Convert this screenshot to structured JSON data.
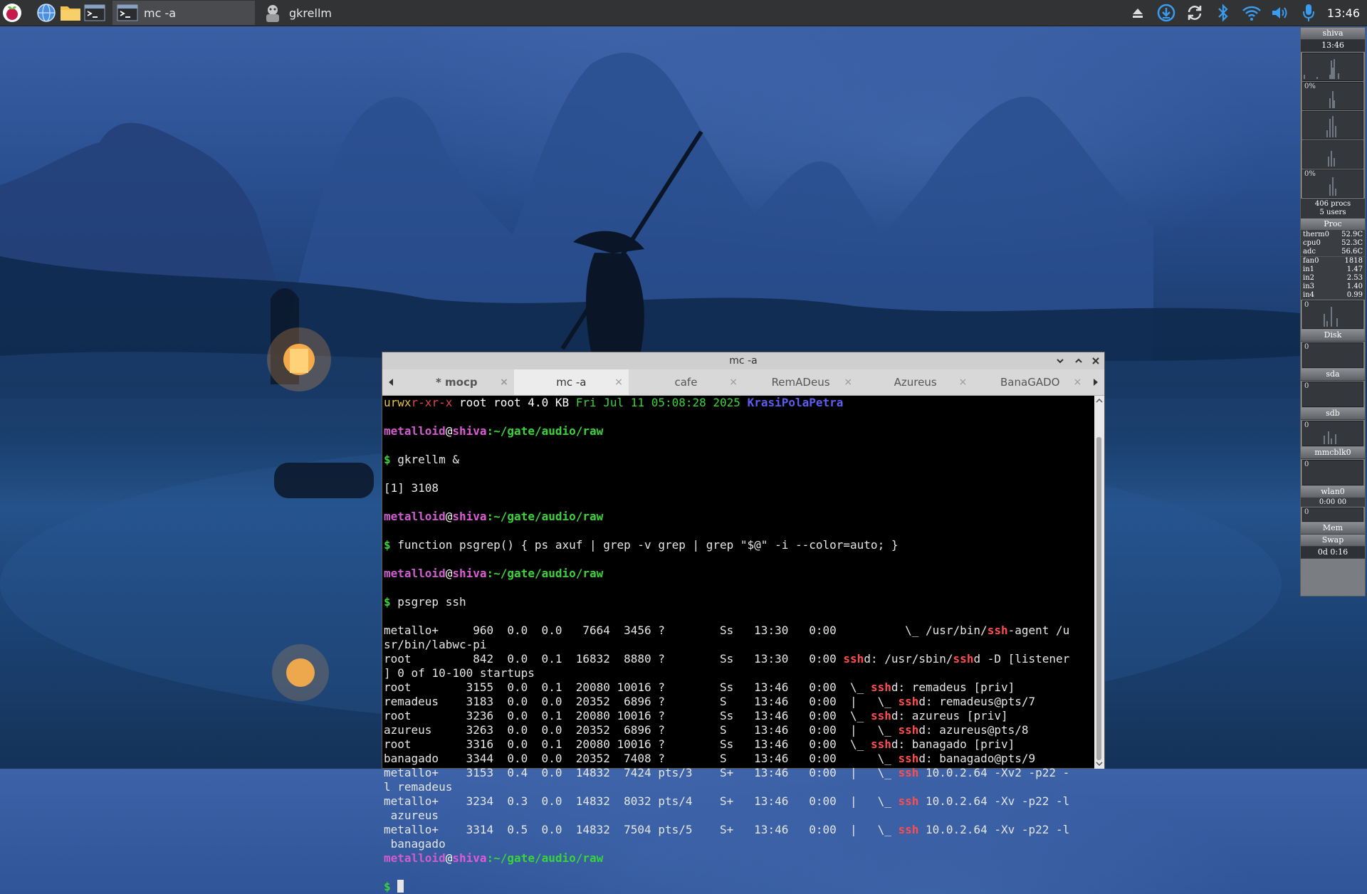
{
  "taskbar": {
    "tasks": [
      {
        "label": "mc -a",
        "active": true
      },
      {
        "label": "gkrellm",
        "active": false
      }
    ],
    "clock": "13:46"
  },
  "gkrellm": {
    "host": "shiva",
    "time": "13:46",
    "cpu1_pct": "0%",
    "cpu2_pct": "0%",
    "procs": "406 procs",
    "users": "5 users",
    "proc_label": "Proc",
    "sensors": [
      {
        "name": "therm0",
        "value": "52.9C"
      },
      {
        "name": "cpu0",
        "value": "52.3C"
      },
      {
        "name": "adc",
        "value": "56.6C"
      }
    ],
    "fan": {
      "name": "fan0",
      "value": "1818"
    },
    "volts": [
      {
        "name": "in1",
        "value": "1.47"
      },
      {
        "name": "in2",
        "value": "2.53"
      },
      {
        "name": "in3",
        "value": "1.40"
      },
      {
        "name": "in4",
        "value": "0.99"
      }
    ],
    "disks": [
      {
        "zero": "0",
        "label": "Disk"
      },
      {
        "zero": "0",
        "label": "sda"
      },
      {
        "zero": "0",
        "label": "sdb"
      },
      {
        "zero": "0",
        "label": "mmcblk0"
      },
      {
        "zero": "0",
        "label": "wlan0"
      }
    ],
    "net_time": "0:00 00",
    "net_zero": "0",
    "mem": "Mem",
    "swap": "Swap",
    "uptime": "0d 0:16"
  },
  "window": {
    "title": "mc -a",
    "tabs": [
      {
        "label": "* mocp",
        "active": false,
        "bold": true
      },
      {
        "label": "mc -a",
        "active": true,
        "bold": false
      },
      {
        "label": "cafe",
        "active": false,
        "bold": false
      },
      {
        "label": "RemADeus",
        "active": false,
        "bold": false
      },
      {
        "label": "Azureus",
        "active": false,
        "bold": false
      },
      {
        "label": "BanaGADO",
        "active": false,
        "bold": false
      }
    ],
    "tab_close": "×"
  },
  "terminal": {
    "header_line": {
      "perms_u": "urwx",
      "perms_g": "r-x",
      "perms_o": "r-x",
      "owner": " root root 4.0 KB ",
      "date": "Fri Jul 11 05:08:28 2025 ",
      "name": "KrasiPolaPetra"
    },
    "prompt": {
      "user": "metalloid",
      "at": "@",
      "host": "shiva",
      "path": ":~/gate/audio/raw",
      "dollar": "$ "
    },
    "cmd1": "gkrellm &",
    "out1": "[1] 3108",
    "cmd2": "function psgrep() { ps axuf | grep -v grep | grep \"$@\" -i --color=auto; }",
    "cmd3": "psgrep ssh",
    "ps_lines": [
      [
        "metallo+     960  0.0  0.0   7664  3456 ?        Ss   13:30   0:00          \\_ /usr/bin/",
        "ssh",
        "-agent /u"
      ],
      [
        "sr/bin/labwc-pi",
        "",
        ""
      ],
      [
        "root         842  0.0  0.1  16832  8880 ?        Ss   13:30   0:00 ",
        "ssh",
        "d: /usr/sbin/",
        "ssh",
        "d -D [listener"
      ],
      [
        "] 0 of 10-100 startups",
        "",
        ""
      ],
      [
        "root        3155  0.0  0.1  20080 10016 ?        Ss   13:46   0:00  \\_ ",
        "ssh",
        "d: remadeus [priv]"
      ],
      [
        "remadeus    3183  0.0  0.0  20352  6896 ?        S    13:46   0:00  |   \\_ ",
        "ssh",
        "d: remadeus@pts/7"
      ],
      [
        "root        3236  0.0  0.1  20080 10016 ?        Ss   13:46   0:00  \\_ ",
        "ssh",
        "d: azureus [priv]"
      ],
      [
        "azureus     3263  0.0  0.0  20352  6896 ?        S    13:46   0:00  |   \\_ ",
        "ssh",
        "d: azureus@pts/8"
      ],
      [
        "root        3316  0.0  0.1  20080 10016 ?        Ss   13:46   0:00  \\_ ",
        "ssh",
        "d: banagado [priv]"
      ],
      [
        "banagado    3344  0.0  0.0  20352  7408 ?        S    13:46   0:00      \\_ ",
        "ssh",
        "d: banagado@pts/9"
      ],
      [
        "metallo+    3153  0.4  0.0  14832  7424 pts/3    S+   13:46   0:00  |   \\_ ",
        "ssh",
        " 10.0.2.64 -Xv2 -p22 -"
      ],
      [
        "l remadeus",
        "",
        ""
      ],
      [
        "metallo+    3234  0.3  0.0  14832  8032 pts/4    S+   13:46   0:00  |   \\_ ",
        "ssh",
        " 10.0.2.64 -Xv -p22 -l"
      ],
      [
        " azureus",
        "",
        ""
      ],
      [
        "metallo+    3314  0.5  0.0  14832  7504 pts/5    S+   13:46   0:00  |   \\_ ",
        "ssh",
        " 10.0.2.64 -Xv -p22 -l"
      ],
      [
        " banagado",
        "",
        ""
      ]
    ]
  },
  "colors": {
    "taskbar": "#323335",
    "prompt_user": "#d05cd0",
    "prompt_path": "#3ad33a",
    "grep_match": "#ff4d4d"
  }
}
